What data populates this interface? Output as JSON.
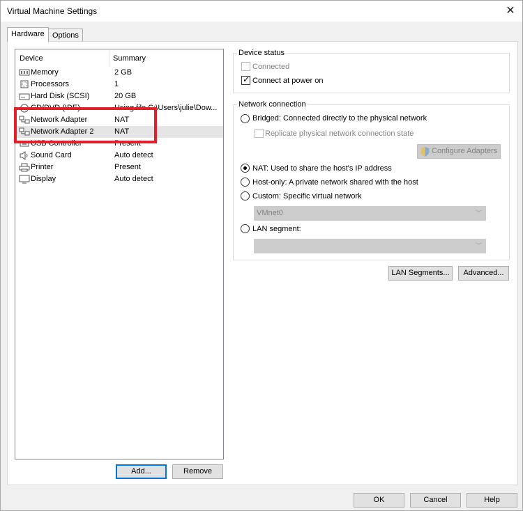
{
  "window": {
    "title": "Virtual Machine Settings"
  },
  "tabs": [
    {
      "label": "Hardware",
      "active": true
    },
    {
      "label": "Options",
      "active": false
    }
  ],
  "device_list": {
    "columns": {
      "device": "Device",
      "summary": "Summary"
    },
    "rows": [
      {
        "icon": "memory-icon",
        "name": "Memory",
        "summary": "2 GB"
      },
      {
        "icon": "processor-icon",
        "name": "Processors",
        "summary": "1"
      },
      {
        "icon": "hard-disk-icon",
        "name": "Hard Disk (SCSI)",
        "summary": "20 GB"
      },
      {
        "icon": "cd-dvd-icon",
        "name": "CD/DVD (IDE)",
        "summary": "Using file C:\\Users\\julie\\Dow..."
      },
      {
        "icon": "network-adapter-icon",
        "name": "Network Adapter",
        "summary": "NAT"
      },
      {
        "icon": "network-adapter-icon",
        "name": "Network Adapter 2",
        "summary": "NAT",
        "selected": true
      },
      {
        "icon": "usb-icon",
        "name": "USB Controller",
        "summary": "Present"
      },
      {
        "icon": "speaker-icon",
        "name": "Sound Card",
        "summary": "Auto detect"
      },
      {
        "icon": "printer-icon",
        "name": "Printer",
        "summary": "Present"
      },
      {
        "icon": "monitor-icon",
        "name": "Display",
        "summary": "Auto detect"
      }
    ],
    "add_button": "Add...",
    "remove_button": "Remove"
  },
  "device_status": {
    "title": "Device status",
    "connected": {
      "label": "Connected",
      "checked": false,
      "enabled": false
    },
    "connect_at_power_on": {
      "label": "Connect at power on",
      "checked": true,
      "enabled": true
    }
  },
  "network_connection": {
    "title": "Network connection",
    "bridged": {
      "label": "Bridged: Connected directly to the physical network",
      "selected": false
    },
    "replicate": {
      "label": "Replicate physical network connection state",
      "checked": false,
      "enabled": false
    },
    "configure_adapters": "Configure Adapters",
    "nat": {
      "label": "NAT: Used to share the host's IP address",
      "selected": true
    },
    "host_only": {
      "label": "Host-only: A private network shared with the host",
      "selected": false
    },
    "custom": {
      "label": "Custom: Specific virtual network",
      "selected": false
    },
    "custom_network_value": "VMnet0",
    "lan_segment": {
      "label": "LAN segment:",
      "selected": false
    },
    "lan_segment_value": ""
  },
  "buttons": {
    "lan_segments": "LAN Segments...",
    "advanced": "Advanced...",
    "ok": "OK",
    "cancel": "Cancel",
    "help": "Help"
  }
}
